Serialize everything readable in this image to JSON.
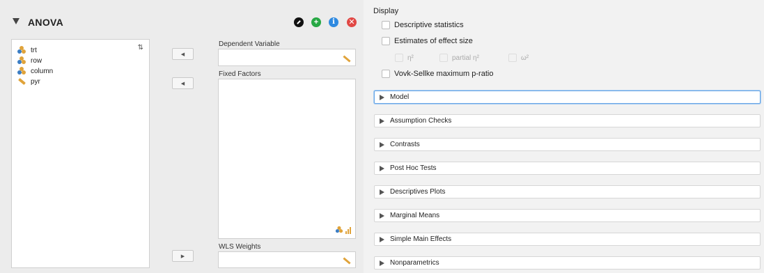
{
  "header": {
    "title": "ANOVA",
    "buttons": [
      {
        "icon": "edit-icon",
        "color": "#111111"
      },
      {
        "icon": "plus-icon",
        "color": "#27a844"
      },
      {
        "icon": "info-icon",
        "color": "#2f8ae0"
      },
      {
        "icon": "close-icon",
        "color": "#e14845"
      }
    ]
  },
  "variables": [
    {
      "label": "trt",
      "type": "nominal"
    },
    {
      "label": "row",
      "type": "nominal"
    },
    {
      "label": "column",
      "type": "nominal"
    },
    {
      "label": "pyr",
      "type": "scale"
    }
  ],
  "targets": {
    "dependent_label": "Dependent Variable",
    "fixed_label": "Fixed Factors",
    "wls_label": "WLS Weights"
  },
  "display": {
    "label": "Display",
    "descriptive": "Descriptive statistics",
    "effect_size": "Estimates of effect size",
    "eta": "η²",
    "partial_eta": "partial η²",
    "omega": "ω²",
    "vs_mpr": "Vovk-Sellke maximum p-ratio"
  },
  "sections": [
    "Model",
    "Assumption Checks",
    "Contrasts",
    "Post Hoc Tests",
    "Descriptives Plots",
    "Marginal Means",
    "Simple Main Effects",
    "Nonparametrics"
  ]
}
